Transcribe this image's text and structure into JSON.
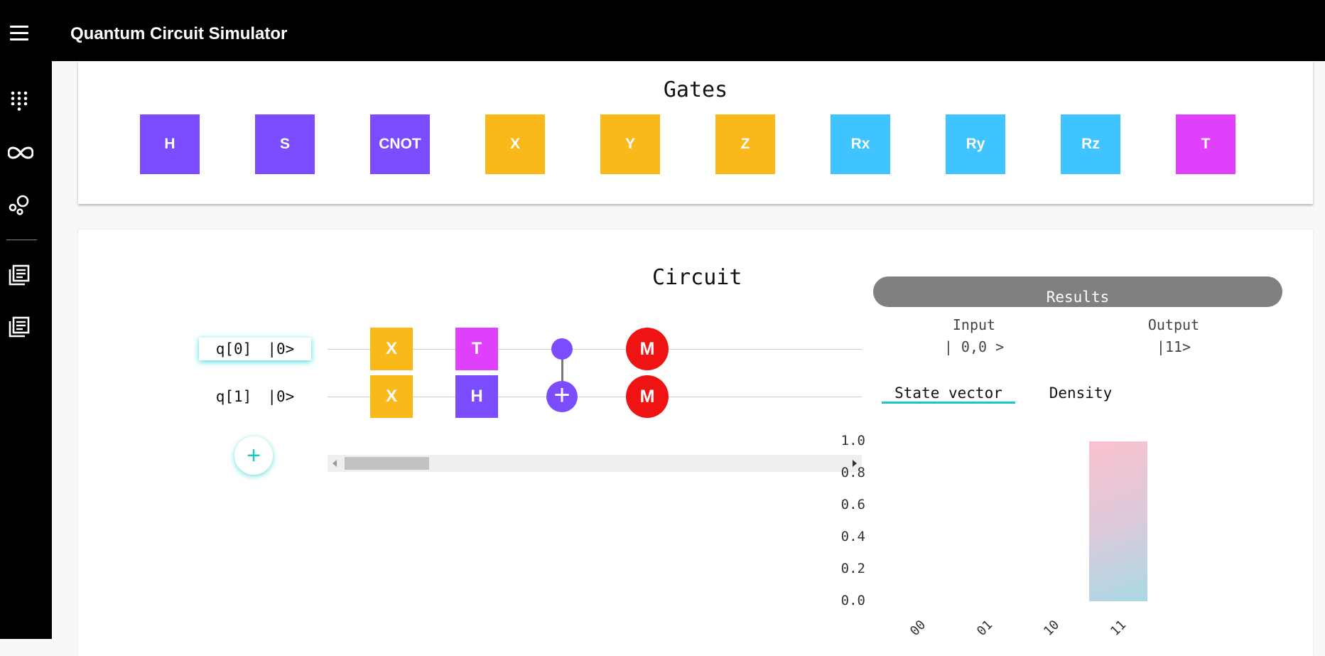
{
  "app": {
    "title": "Quantum Circuit Simulator"
  },
  "gates_panel": {
    "title": "Gates",
    "gates": [
      {
        "label": "H",
        "color": "#7c4dff"
      },
      {
        "label": "S",
        "color": "#7c4dff"
      },
      {
        "label": "CNOT",
        "color": "#7c4dff"
      },
      {
        "label": "X",
        "color": "#fbb81b"
      },
      {
        "label": "Y",
        "color": "#fbb81b"
      },
      {
        "label": "Z",
        "color": "#fbb81b"
      },
      {
        "label": "Rx",
        "color": "#40c4ff"
      },
      {
        "label": "Ry",
        "color": "#40c4ff"
      },
      {
        "label": "Rz",
        "color": "#40c4ff"
      },
      {
        "label": "T",
        "color": "#e040fb"
      }
    ]
  },
  "circuit": {
    "title": "Circuit",
    "qubits": [
      {
        "name": "q[0]",
        "state": "|0>"
      },
      {
        "name": "q[1]",
        "state": "|0>"
      }
    ],
    "placed_gates": {
      "q0": [
        {
          "label": "X",
          "color": "#fbb81b"
        },
        {
          "label": "T",
          "color": "#e040fb"
        },
        {
          "label": "",
          "kind": "control"
        },
        {
          "label": "M",
          "color": "#f01313"
        }
      ],
      "q1": [
        {
          "label": "X",
          "color": "#fbb81b"
        },
        {
          "label": "H",
          "color": "#7c4dff"
        },
        {
          "label": "+",
          "kind": "target"
        },
        {
          "label": "M",
          "color": "#f01313"
        }
      ]
    },
    "add_qubit_label": "+"
  },
  "results": {
    "title": "Results",
    "input_label": "Input",
    "input_value": "| 0,0 >",
    "output_label": "Output",
    "output_value": "|11>",
    "tabs": [
      {
        "label": "State vector",
        "active": true
      },
      {
        "label": "Density",
        "active": false
      }
    ],
    "chart_data": {
      "type": "bar",
      "categories": [
        "00",
        "01",
        "10",
        "11"
      ],
      "values": [
        0,
        0,
        0,
        1.0
      ],
      "ylim": [
        0,
        1.0
      ],
      "yticks": [
        "1.0",
        "0.8",
        "0.6",
        "0.4",
        "0.2",
        "0.0"
      ],
      "bar_color_gradient": [
        "#fac2cf",
        "#a9d9e6"
      ]
    }
  },
  "sidebar": {
    "items": [
      {
        "icon": "dialpad-icon"
      },
      {
        "icon": "infinity-icon"
      },
      {
        "icon": "bubbles-icon"
      },
      {
        "icon": "library-books-icon"
      },
      {
        "icon": "library-books-icon"
      }
    ]
  }
}
